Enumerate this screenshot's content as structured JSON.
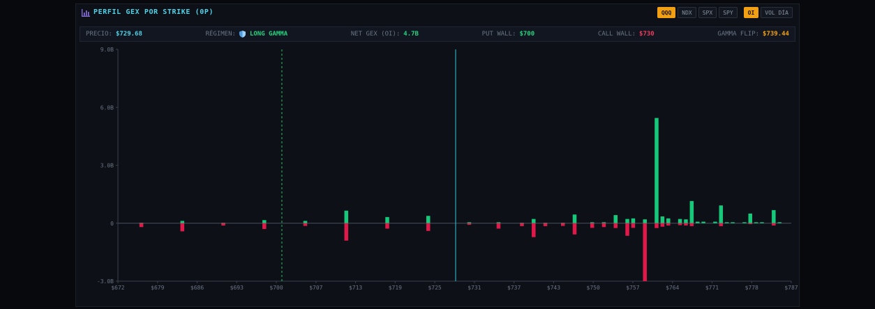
{
  "header": {
    "title": "PERFIL GEX POR STRIKE (0P)",
    "tickers": [
      "QQQ",
      "NDX",
      "SPX",
      "SPY"
    ],
    "active_ticker": "QQQ",
    "modes": [
      "OI",
      "VOL DÍA"
    ],
    "active_mode": "OI"
  },
  "stats": {
    "precio_label": "PRECIO:",
    "precio_value": "$729.68",
    "regimen_label": "RÉGIMEN:",
    "regimen_value": "LONG GAMMA",
    "netgex_label": "NET GEX (OI):",
    "netgex_value": "4.7B",
    "putwall_label": "PUT WALL:",
    "putwall_value": "$700",
    "callwall_label": "CALL WALL:",
    "callwall_value": "$730",
    "gammaflip_label": "GAMMA FLIP:",
    "gammaflip_value": "$739.44"
  },
  "colors": {
    "accent": "#4fd1e6",
    "positive": "#16c97a",
    "negative": "#e0194a",
    "price_line": "#33c7dd",
    "put_wall_line": "#22c55e",
    "active_button": "#f0a012",
    "precio": "#4fd1e6",
    "regimen": "#22d37e",
    "netgex": "#22d37e",
    "putwall": "#22d37e",
    "callwall": "#f03a5a",
    "gammaflip": "#f0a012"
  },
  "chart_data": {
    "type": "bar",
    "y_ticks": [
      "9.0B",
      "6.0B",
      "3.0B",
      "0",
      "-3.0B"
    ],
    "x_ticks": [
      "$672",
      "$679",
      "$686",
      "$693",
      "$700",
      "$707",
      "$713",
      "$719",
      "$725",
      "$731",
      "$737",
      "$743",
      "$750",
      "$757",
      "$764",
      "$771",
      "$778",
      "$787"
    ],
    "xlim": [
      672,
      787
    ],
    "ylim": [
      -3.0,
      9.0
    ],
    "put_wall_line": 700,
    "price_line": 729.68,
    "call_bars": [
      {
        "x": 676,
        "value": 0.02
      },
      {
        "x": 683,
        "value": 0.12
      },
      {
        "x": 690,
        "value": 0.02
      },
      {
        "x": 697,
        "value": 0.16
      },
      {
        "x": 704,
        "value": 0.12
      },
      {
        "x": 711,
        "value": 0.65
      },
      {
        "x": 718,
        "value": 0.32
      },
      {
        "x": 725,
        "value": 0.38
      },
      {
        "x": 732,
        "value": 0.05
      },
      {
        "x": 737,
        "value": 0.05
      },
      {
        "x": 741,
        "value": 0.02
      },
      {
        "x": 743,
        "value": 0.22
      },
      {
        "x": 745,
        "value": 0.02
      },
      {
        "x": 748,
        "value": 0.02
      },
      {
        "x": 750,
        "value": 0.45
      },
      {
        "x": 753,
        "value": 0.05
      },
      {
        "x": 755,
        "value": 0.05
      },
      {
        "x": 757,
        "value": 0.42
      },
      {
        "x": 759,
        "value": 0.22
      },
      {
        "x": 760,
        "value": 0.25
      },
      {
        "x": 762,
        "value": 0.2
      },
      {
        "x": 764,
        "value": 5.45
      },
      {
        "x": 765,
        "value": 0.35
      },
      {
        "x": 766,
        "value": 0.25
      },
      {
        "x": 768,
        "value": 0.22
      },
      {
        "x": 769,
        "value": 0.2
      },
      {
        "x": 770,
        "value": 1.15
      },
      {
        "x": 771,
        "value": 0.08
      },
      {
        "x": 772,
        "value": 0.08
      },
      {
        "x": 774,
        "value": 0.08
      },
      {
        "x": 775,
        "value": 0.92
      },
      {
        "x": 776,
        "value": 0.05
      },
      {
        "x": 777,
        "value": 0.05
      },
      {
        "x": 779,
        "value": 0.05
      },
      {
        "x": 780,
        "value": 0.5
      },
      {
        "x": 781,
        "value": 0.05
      },
      {
        "x": 782,
        "value": 0.05
      },
      {
        "x": 784,
        "value": 0.68
      },
      {
        "x": 785,
        "value": 0.05
      }
    ],
    "put_bars": [
      {
        "x": 676,
        "value": -0.2
      },
      {
        "x": 683,
        "value": -0.42
      },
      {
        "x": 690,
        "value": -0.12
      },
      {
        "x": 697,
        "value": -0.3
      },
      {
        "x": 704,
        "value": -0.14
      },
      {
        "x": 711,
        "value": -0.9
      },
      {
        "x": 718,
        "value": -0.28
      },
      {
        "x": 725,
        "value": -0.4
      },
      {
        "x": 732,
        "value": -0.08
      },
      {
        "x": 737,
        "value": -0.28
      },
      {
        "x": 741,
        "value": -0.15
      },
      {
        "x": 743,
        "value": -0.72
      },
      {
        "x": 745,
        "value": -0.15
      },
      {
        "x": 748,
        "value": -0.14
      },
      {
        "x": 750,
        "value": -0.58
      },
      {
        "x": 753,
        "value": -0.24
      },
      {
        "x": 755,
        "value": -0.2
      },
      {
        "x": 757,
        "value": -0.25
      },
      {
        "x": 759,
        "value": -0.65
      },
      {
        "x": 760,
        "value": -0.24
      },
      {
        "x": 762,
        "value": -3.0
      },
      {
        "x": 764,
        "value": -0.25
      },
      {
        "x": 765,
        "value": -0.18
      },
      {
        "x": 766,
        "value": -0.12
      },
      {
        "x": 768,
        "value": -0.1
      },
      {
        "x": 769,
        "value": -0.12
      },
      {
        "x": 770,
        "value": -0.15
      },
      {
        "x": 775,
        "value": -0.15
      },
      {
        "x": 780,
        "value": -0.05
      },
      {
        "x": 784,
        "value": -0.12
      }
    ]
  }
}
